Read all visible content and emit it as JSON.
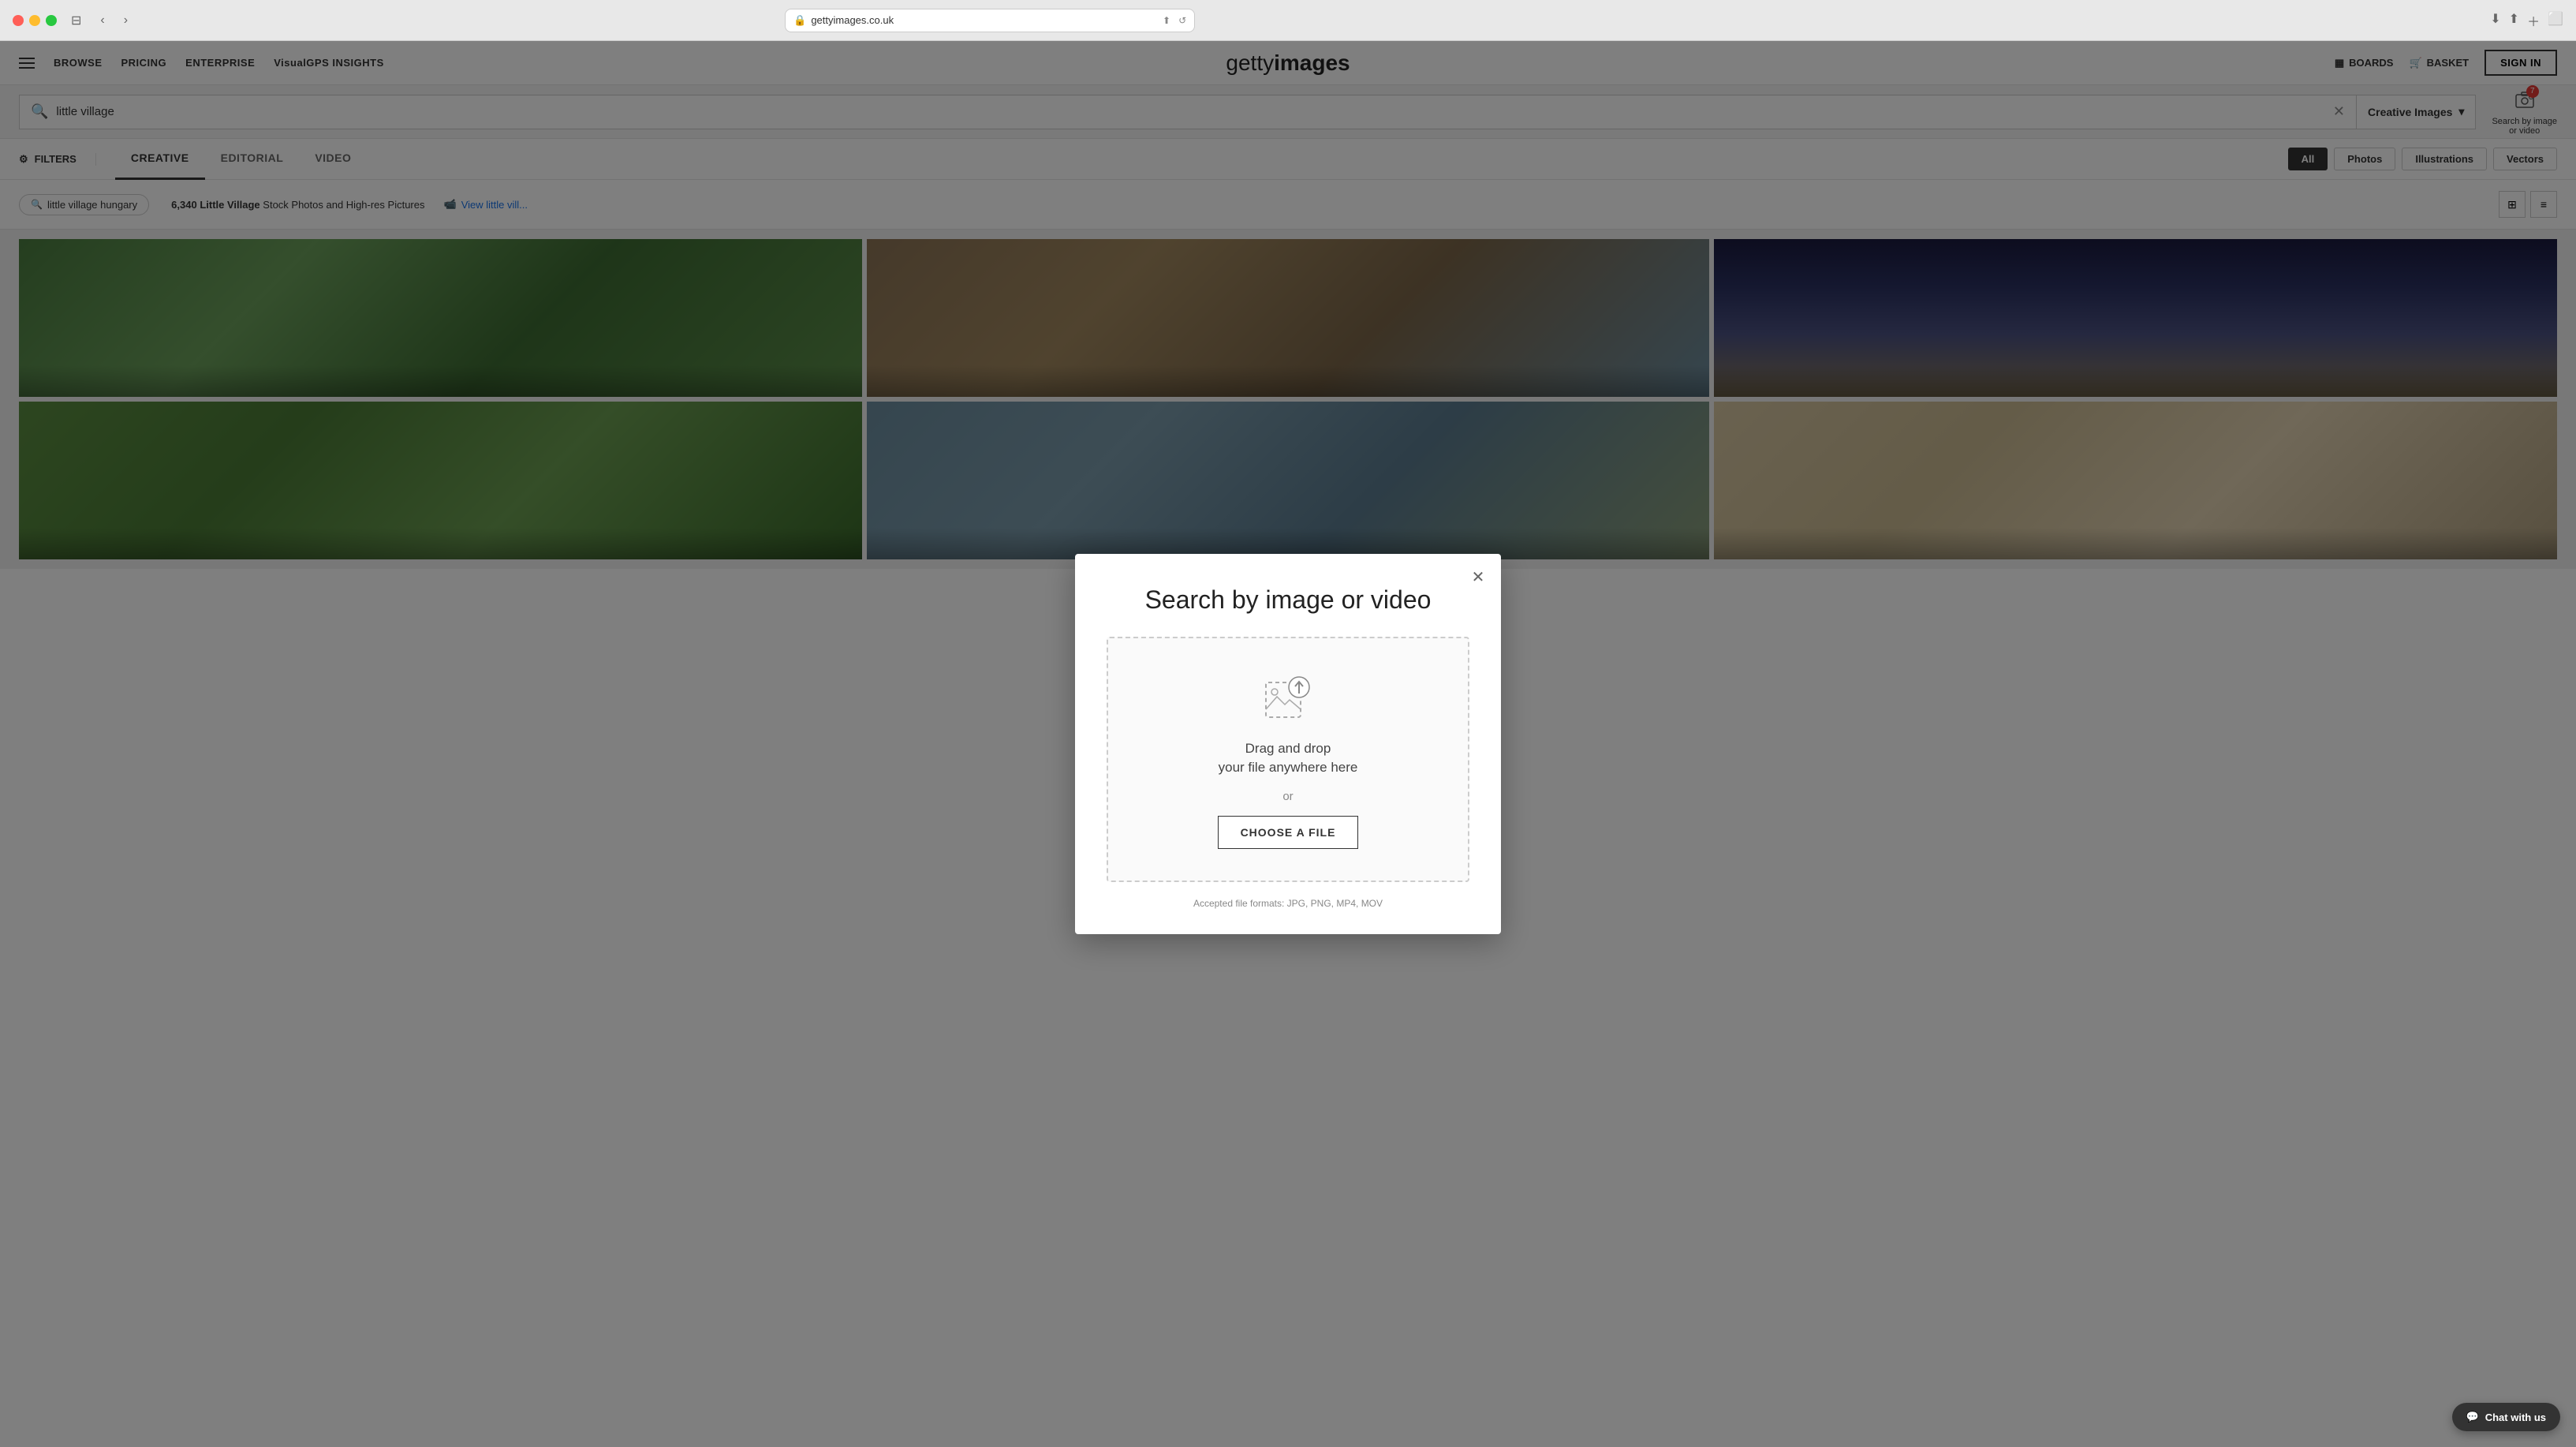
{
  "browser": {
    "url": "gettyimages.co.uk"
  },
  "nav": {
    "browse": "BROWSE",
    "pricing": "PRICING",
    "enterprise": "ENTERPRISE",
    "visualgps": "VisualGPS INSIGHTS",
    "logo_light": "getty",
    "logo_bold": "images",
    "boards": "BOARDS",
    "basket": "BASKET",
    "sign_in": "SIGN IN"
  },
  "search": {
    "query": "little village",
    "type": "Creative Images",
    "search_by_image_label": "Search by image\nor video"
  },
  "filter_tabs": [
    {
      "label": "CREATIVE",
      "active": true
    },
    {
      "label": "EDITORIAL",
      "active": false
    },
    {
      "label": "VIDEO",
      "active": false
    }
  ],
  "filters_label": "FILTERS",
  "type_filters": [
    {
      "label": "All",
      "active": true
    },
    {
      "label": "Photos",
      "active": false
    },
    {
      "label": "Illustrations",
      "active": false
    },
    {
      "label": "Vectors",
      "active": false
    }
  ],
  "results": {
    "count": "6,340",
    "subject": "Little Village",
    "suffix": "Stock Photos and High-res Pictures",
    "video_link": "View little vill...",
    "suggestion": "little village hungary"
  },
  "modal": {
    "title": "Search by image or video",
    "drag_text": "Drag and drop",
    "drag_subtext": "your file anywhere here",
    "or_text": "or",
    "choose_file": "CHOOSE A FILE",
    "accepted_formats": "Accepted file formats: JPG, PNG, MP4, MOV"
  },
  "chat": {
    "label": "Chat with us"
  },
  "images": [
    {
      "bg_class": "img-green-hills"
    },
    {
      "bg_class": "img-village-street"
    },
    {
      "bg_class": "img-night-hills"
    },
    {
      "bg_class": "img-green-valley"
    },
    {
      "bg_class": "img-tuscany"
    },
    {
      "bg_class": "img-italian-street"
    }
  ]
}
